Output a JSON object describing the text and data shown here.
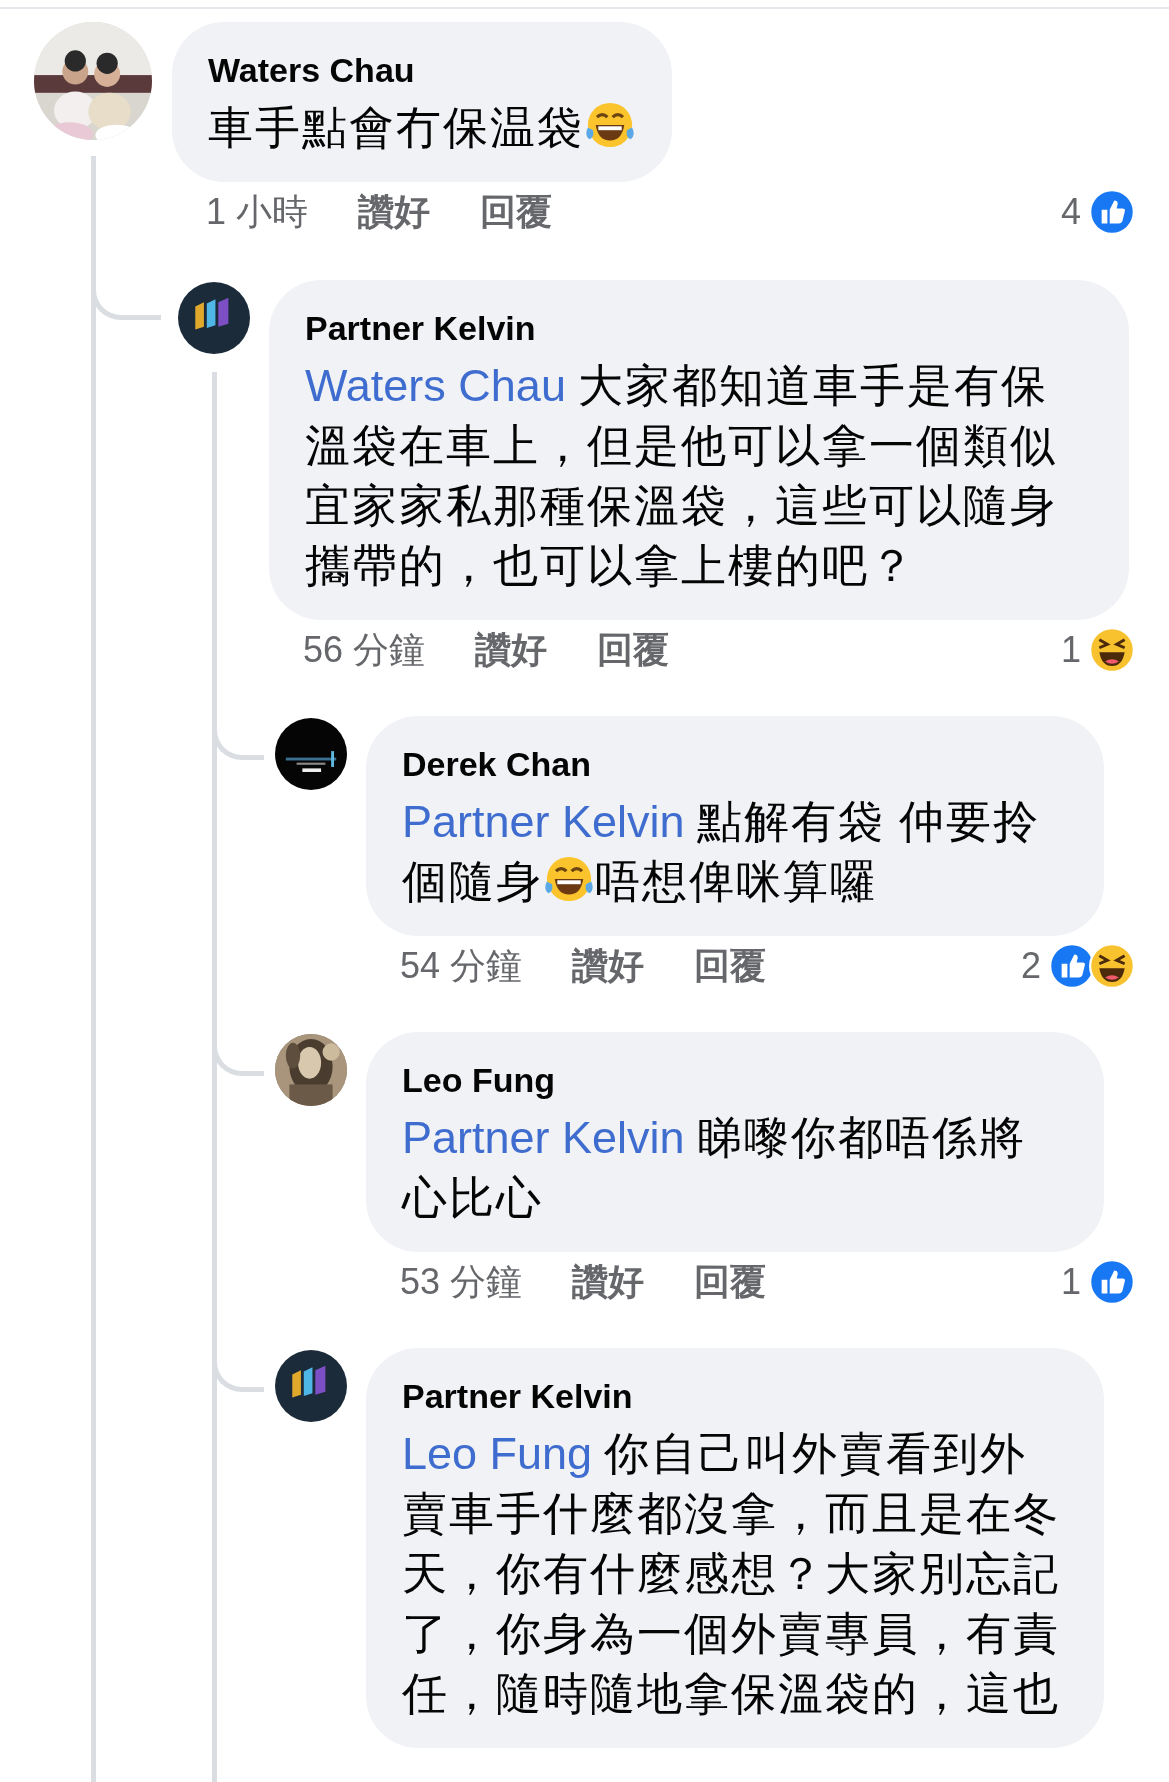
{
  "comments": [
    {
      "author": "Waters Chau",
      "avatar": {
        "kind": "picture"
      },
      "body": [
        {
          "kind": "text",
          "text": "車手點會冇保温袋"
        },
        {
          "kind": "emoji"
        }
      ],
      "time": "1 小時",
      "like_label": "讚好",
      "reply_label": "回覆",
      "reaction_count": "4",
      "reactions": [
        {
          "kind": "like"
        }
      ],
      "children": [
        {
          "author": "Partner Kelvin",
          "avatar": {
            "kind": "logo"
          },
          "body": [
            {
              "kind": "mention",
              "text": "Waters Chau"
            },
            {
              "kind": "text",
              "text": "大家都知道車手是有保溫袋在車上，但是他可以拿一個類似宜家家私那種保溫袋，這些可以隨身攜帶的，也可以拿上樓的吧？"
            }
          ],
          "time": "56 分鐘",
          "like_label": "讚好",
          "reply_label": "回覆",
          "reaction_count": "1",
          "reactions": [
            {
              "kind": "haha"
            }
          ],
          "children": [
            {
              "author": "Derek Chan",
              "avatar": {
                "kind": "picture"
              },
              "body": [
                {
                  "kind": "mention",
                  "text": "Partner Kelvin"
                },
                {
                  "kind": "text",
                  "text": "點解有袋 仲要拎個隨身"
                },
                {
                  "kind": "emoji"
                },
                {
                  "kind": "text",
                  "text": "唔想俾咪算囉"
                }
              ],
              "time": "54 分鐘",
              "like_label": "讚好",
              "reply_label": "回覆",
              "reaction_count": "2",
              "reactions": [
                {
                  "kind": "like"
                },
                {
                  "kind": "haha"
                }
              ]
            },
            {
              "author": "Leo Fung",
              "avatar": {
                "kind": "picture"
              },
              "body": [
                {
                  "kind": "mention",
                  "text": "Partner Kelvin"
                },
                {
                  "kind": "text",
                  "text": "睇嚟你都唔係將心比心"
                }
              ],
              "time": "53 分鐘",
              "like_label": "讚好",
              "reply_label": "回覆",
              "reaction_count": "1",
              "reactions": [
                {
                  "kind": "like"
                }
              ]
            },
            {
              "author": "Partner Kelvin",
              "avatar": {
                "kind": "logo"
              },
              "body": [
                {
                  "kind": "mention",
                  "text": "Leo Fung"
                },
                {
                  "kind": "text",
                  "text": "你自己叫外賣看到外賣車手什麼都沒拿，而且是在冬天，你有什麼感想？大家別忘記了，你身為一個外賣專員，有責任，隨時隨地拿保溫袋的，這也"
                }
              ]
            }
          ]
        }
      ]
    }
  ]
}
